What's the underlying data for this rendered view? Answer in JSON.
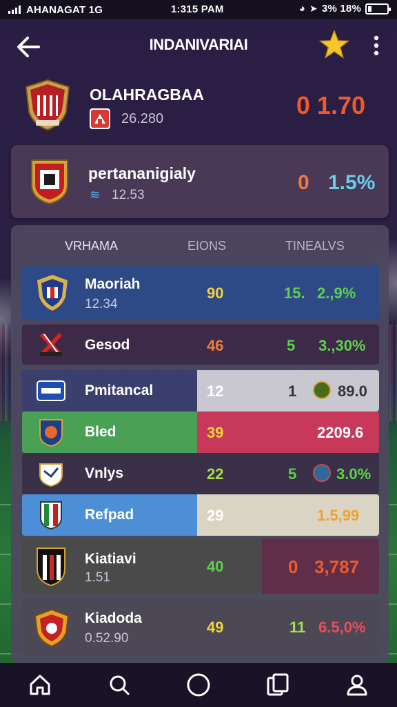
{
  "status_bar": {
    "carrier": "AHANAGAT  1G",
    "time": "1:315 PAM",
    "battery_text": "3% 18%"
  },
  "header": {
    "title": "INDANIVARIAI"
  },
  "team_main": {
    "name": "OLAHRAGBAA",
    "sub": "26.280",
    "odds": "0  1.70"
  },
  "card2": {
    "name": "pertananigialy",
    "sub": "12.53",
    "odds_a": "0",
    "odds_b": "1.5%"
  },
  "table": {
    "headers": [
      "VRHAMA",
      "EIONS",
      "TINEALVS"
    ],
    "rows": [
      {
        "name": "Maoriah",
        "sub": "12.34",
        "value": "90",
        "odds1": "15.",
        "odds2": "2.,9%"
      },
      {
        "name": "Gesod",
        "sub": "",
        "value": "46",
        "odds1": "5",
        "odds2": "3.,30%"
      },
      {
        "name": "Pmitancal",
        "sub": "",
        "value": "12",
        "odds1": "1",
        "odds2": "89.0"
      },
      {
        "name": "Bled",
        "sub": "",
        "value": "39",
        "odds1": "",
        "odds2": "2209.6"
      },
      {
        "name": "Vnlys",
        "sub": "",
        "value": "22",
        "odds1": "5",
        "odds2": "3.0%"
      },
      {
        "name": "Refpad",
        "sub": "",
        "value": "29",
        "odds1": "",
        "odds2": "1.5,99"
      },
      {
        "name": "Kiatiavi",
        "sub": "1.51",
        "value": "40",
        "odds1": "0",
        "odds2": "3,787"
      },
      {
        "name": "Kiadoda",
        "sub": "0.52.90",
        "value": "49",
        "odds1": "11",
        "odds2": "6.5,0%"
      }
    ]
  },
  "colors": {
    "accent_orange": "#ef5a2c",
    "accent_green": "#5bd24a",
    "accent_yellow": "#f2d436",
    "accent_cyan": "#67cde9"
  },
  "icons": {
    "nav": [
      "home-icon",
      "search-icon",
      "circle-icon",
      "tickets-icon",
      "profile-icon"
    ]
  }
}
